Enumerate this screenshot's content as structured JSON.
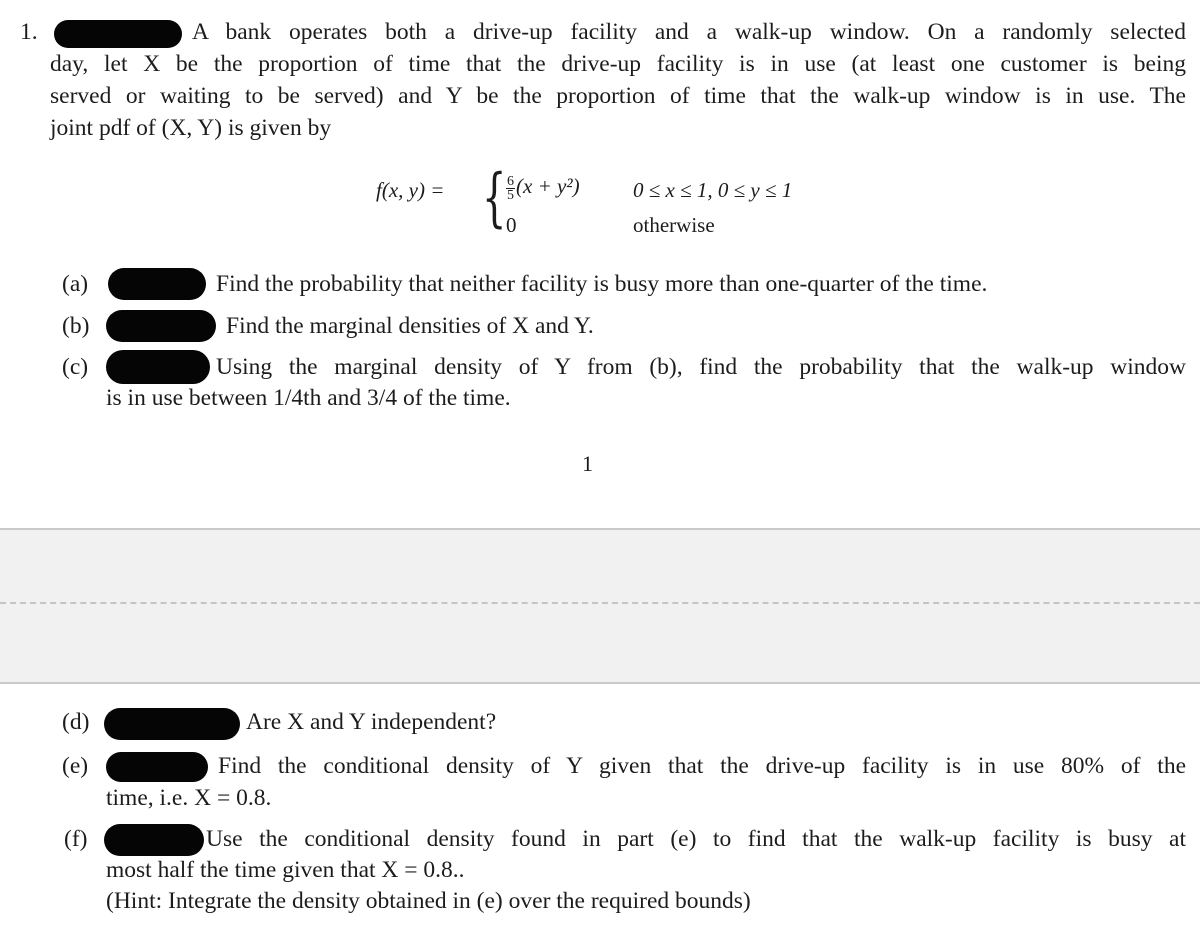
{
  "problem": {
    "number": "1.",
    "intro_lines": [
      "A bank operates both a drive-up facility and a walk-up window.  On a randomly selected",
      "day, let X be the proportion of time that the drive-up facility is in use (at least one customer is being",
      "served or waiting to be served) and Y be the proportion of time that the walk-up window is in use.  The",
      "joint pdf of (X, Y) is given by"
    ],
    "pdf": {
      "lhs": "f(x, y) =",
      "case1_frac_num": "6",
      "case1_frac_den": "5",
      "case1_expr": "(x + y²)",
      "case1_cond": "0 ≤ x ≤ 1, 0 ≤ y ≤ 1",
      "case2_expr": "0",
      "case2_cond": "otherwise"
    }
  },
  "parts": [
    {
      "label": "(a)",
      "lines": [
        "Find the probability that neither facility is busy more than one-quarter of the time."
      ]
    },
    {
      "label": "(b)",
      "lines": [
        "Find the marginal densities of X and Y."
      ]
    },
    {
      "label": "(c)",
      "lines": [
        "Using the marginal density of Y from (b), find the probability that the walk-up window",
        "is in use between 1/4th and 3/4 of the time."
      ]
    },
    {
      "label": "(d)",
      "lines": [
        "Are X and Y independent?"
      ]
    },
    {
      "label": "(e)",
      "lines": [
        "Find the conditional density of Y given that the drive-up facility is in use 80% of the",
        "time, i.e. X = 0.8."
      ]
    },
    {
      "label": "(f)",
      "lines": [
        "Use the conditional density found in part (e) to find that the walk-up facility is busy at",
        "most half the time given that X = 0.8..",
        "(Hint: Integrate the density obtained in (e) over the required bounds)"
      ]
    }
  ],
  "page_number": "1"
}
